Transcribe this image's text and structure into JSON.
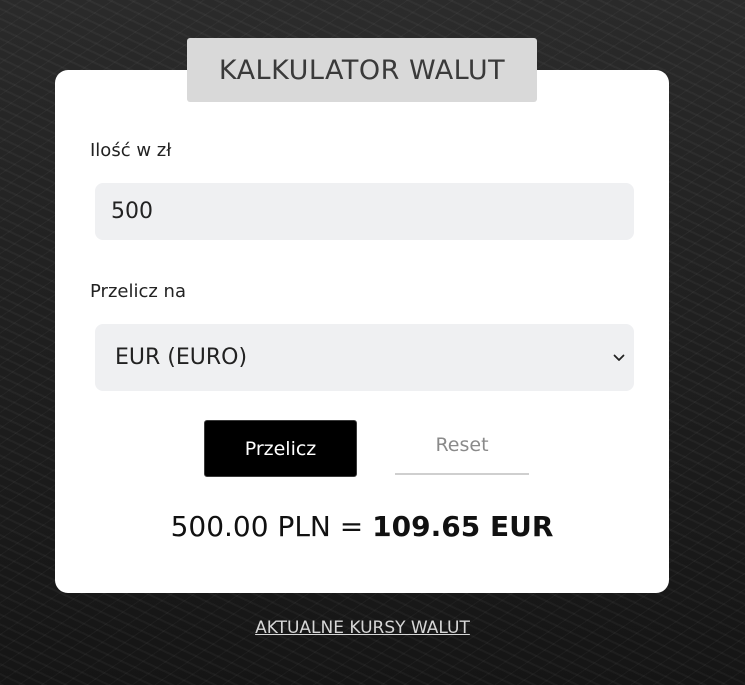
{
  "header": {
    "title": "KALKULATOR WALUT"
  },
  "form": {
    "amount_label": "Ilość w zł",
    "amount_value": "500",
    "convert_label": "Przelicz na",
    "currency_selected": "EUR (EURO)",
    "convert_button": "Przelicz",
    "reset_button": "Reset"
  },
  "result": {
    "source": "500.00 PLN",
    "equals": "=",
    "value": "109.65 EUR"
  },
  "footer": {
    "rates_link": "AKTUALNE KURSY WALUT"
  },
  "colors": {
    "card_background": "#ffffff",
    "title_tab": "#d9d9d9",
    "input_background": "#eff0f2",
    "primary_button": "#000000",
    "reset_text": "#8a8a8a"
  }
}
